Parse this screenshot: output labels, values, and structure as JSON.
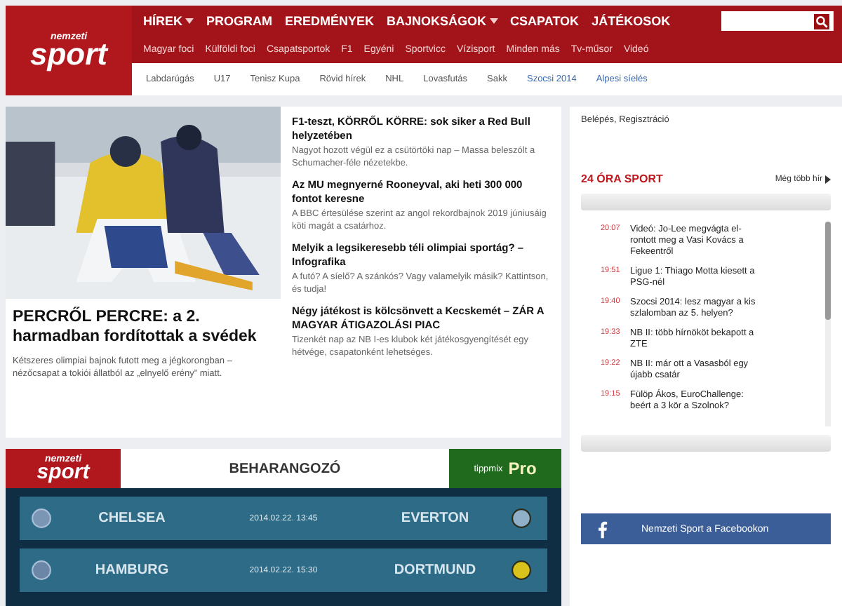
{
  "logo": {
    "top": "nemzeti",
    "bottom": "sport"
  },
  "nav": [
    {
      "label": "HÍREK",
      "caret": true
    },
    {
      "label": "PROGRAM",
      "caret": false
    },
    {
      "label": "EREDMÉNYEK",
      "caret": false
    },
    {
      "label": "BAJNOKSÁGOK",
      "caret": true
    },
    {
      "label": "CSAPATOK",
      "caret": false
    },
    {
      "label": "JÁTÉKOSOK",
      "caret": false
    }
  ],
  "subnav": [
    "Magyar foci",
    "Külföldi foci",
    "Csapatsportok",
    "F1",
    "Egyéni",
    "Sportvicc",
    "Vízisport",
    "Minden más",
    "Tv-műsor",
    "Videó"
  ],
  "tags": [
    "Labdarúgás",
    "U17",
    "Tenisz Kupa",
    "Rövid hírek",
    "NHL",
    "Lovasfutás",
    "Sakk",
    "Szocsi 2014",
    "Alpesi síelés"
  ],
  "lead": {
    "title": "PERCRŐL PERCRE: a 2. harmadban fordítottak a svédek",
    "summary": "Kétszeres olimpiai bajnok futott meg a jégkorongban – nézőcsapat a tokiói állatból az „elnyelő erény” miatt."
  },
  "headlines": [
    {
      "title": "F1-teszt, KÖRRŐL KÖRRE: sok siker a Red Bull helyzetében",
      "summary": "Nagyot hozott végül ez a csütörtöki nap – Massa beleszólt a Schumacher-féle nézetekbe."
    },
    {
      "title": "Az MU megnyerné Rooneyval, aki heti 300 000 fontot keresne",
      "summary": "A BBC értesülése szerint az angol rekordbajnok 2019 júniusáig köti magát a csatárhoz."
    },
    {
      "title": "Melyik a legsikeresebb téli olimpiai sportág? – Infografika",
      "summary": "A futó? A síelő? A szánkós? Vagy valamelyik másik? Kattintson, és tudja!"
    },
    {
      "title": "Négy játékost is kölcsönvett a Kecskemét – ZÁR A MAGYAR ÁTIGAZOLÁSI PIAC",
      "summary": "Tizenkét nap az NB I-es klubok két játékosgyengítését egy hétvége, csapatonként lehetséges."
    }
  ],
  "account": "Belépés, Regisztráció",
  "feed": {
    "title": "24 ÓRA SPORT",
    "more": "Még több hír",
    "items": [
      {
        "time": "20:07",
        "text": "Videó: Jo-Lee megvágta el-rontott meg a Vasi Kovács a Fekeentről"
      },
      {
        "time": "19:51",
        "text": "Ligue 1: Thiago Motta kiesett a PSG-nél"
      },
      {
        "time": "19:40",
        "text": "Szocsi 2014: lesz magyar a kis szlalomban az 5. helyen?"
      },
      {
        "time": "19:33",
        "text": "NB II: több hírnököt bekapott a ZTE"
      },
      {
        "time": "19:22",
        "text": "NB II: már ott a Vasasból egy újabb csatár"
      },
      {
        "time": "19:15",
        "text": "Fülöp Ákos, EuroChallenge: beért a 3 kör a Szolnok?"
      }
    ]
  },
  "preview": {
    "logo": {
      "top": "nemzeti",
      "bottom": "sport"
    },
    "title": "BEHARANGOZÓ",
    "sponsor": {
      "name": "tippmix",
      "tag": "Pro"
    },
    "matches": [
      {
        "home": "CHELSEA",
        "date": "2014.02.22. 13:45",
        "away": "EVERTON"
      },
      {
        "home": "HAMBURG",
        "date": "2014.02.22. 15:30",
        "away": "DORTMUND"
      }
    ]
  },
  "facebook": "Nemzeti Sport a Facebookon"
}
